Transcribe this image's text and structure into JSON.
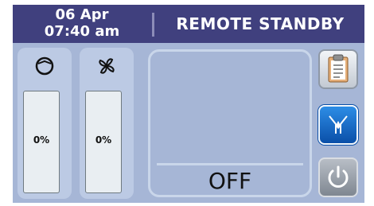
{
  "header": {
    "date": "06 Apr",
    "time": "07:40 am",
    "mode_title": "REMOTE STANDBY"
  },
  "gauges": [
    {
      "icon": "compressor-icon",
      "label": "0%",
      "level": 0
    },
    {
      "icon": "fan-icon",
      "label": "0%",
      "level": 0
    }
  ],
  "center_panel": {
    "status": "OFF"
  },
  "side_buttons": [
    {
      "icon": "clipboard-icon"
    },
    {
      "icon": "drain-valve-icon"
    },
    {
      "icon": "power-icon"
    }
  ],
  "colors": {
    "header_bg": "#40407e",
    "panel_bg": "#a6b6d6",
    "active_button": "#1a6fd0"
  }
}
